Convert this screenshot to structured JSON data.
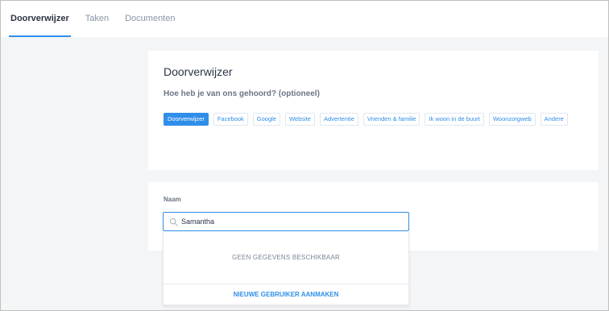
{
  "tabs": [
    {
      "label": "Doorverwijzer",
      "active": true
    },
    {
      "label": "Taken",
      "active": false
    },
    {
      "label": "Documenten",
      "active": false
    }
  ],
  "referral": {
    "title": "Doorverwijzer",
    "question": "Hoe heb je van ons gehoord? (optioneel)",
    "options": [
      {
        "label": "Doorverwijzer",
        "selected": true
      },
      {
        "label": "Facebook",
        "selected": false
      },
      {
        "label": "Google",
        "selected": false
      },
      {
        "label": "Website",
        "selected": false
      },
      {
        "label": "Advertentie",
        "selected": false
      },
      {
        "label": "Vrienden & familie",
        "selected": false
      },
      {
        "label": "Ik woon in de buurt",
        "selected": false
      },
      {
        "label": "Woonzorgweb",
        "selected": false
      },
      {
        "label": "Andere",
        "selected": false
      }
    ]
  },
  "name_field": {
    "label": "Naam",
    "value": "Samantha",
    "icon": "search-icon"
  },
  "dropdown": {
    "empty_text": "GEEN GEGEVENS BESCHIKBAAR",
    "create_label": "NIEUWE GEBRUIKER AANMAKEN"
  },
  "colors": {
    "accent": "#2f8ee9",
    "text_dark": "#2b3445",
    "background": "#f4f5f7"
  }
}
